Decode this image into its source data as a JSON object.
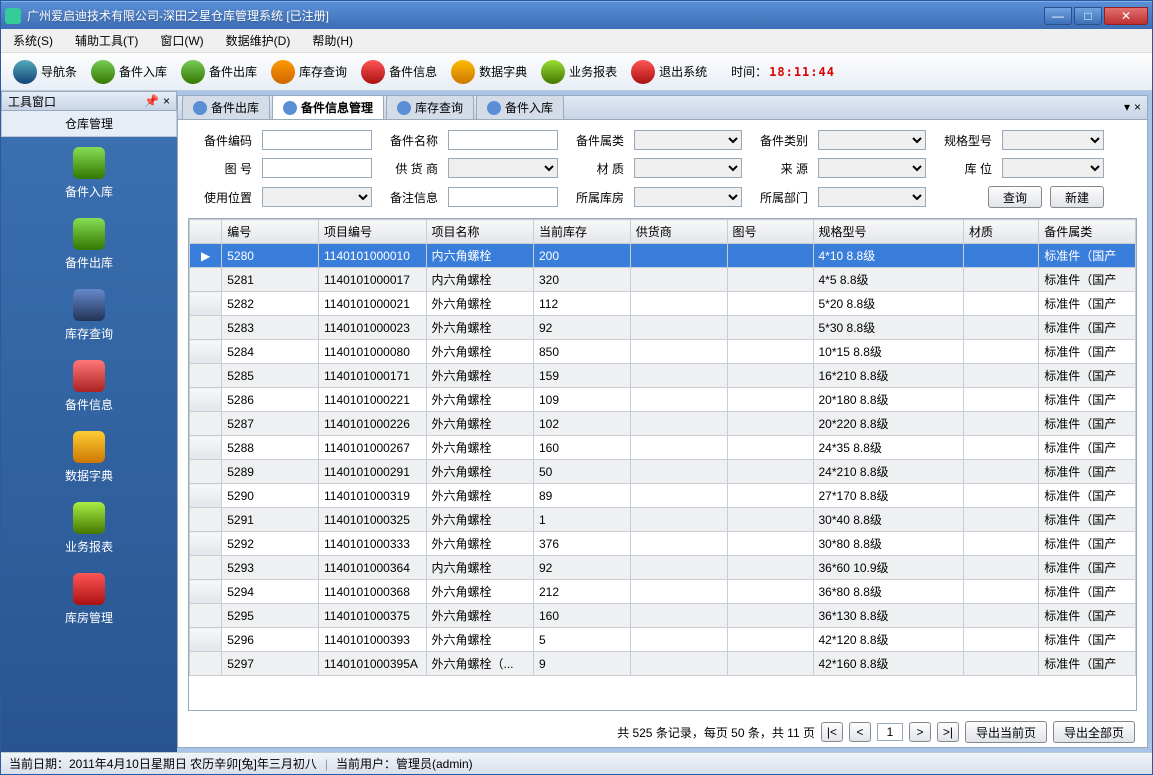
{
  "window": {
    "title": "广州爱启迪技术有限公司-深田之星仓库管理系统 [已注册]"
  },
  "menu": [
    "系统(S)",
    "辅助工具(T)",
    "窗口(W)",
    "数据维护(D)",
    "帮助(H)"
  ],
  "toolbar": [
    {
      "label": "导航条",
      "ico": "ico-nav"
    },
    {
      "label": "备件入库",
      "ico": "ico-in"
    },
    {
      "label": "备件出库",
      "ico": "ico-out"
    },
    {
      "label": "库存查询",
      "ico": "ico-srch"
    },
    {
      "label": "备件信息",
      "ico": "ico-info"
    },
    {
      "label": "数据字典",
      "ico": "ico-dict"
    },
    {
      "label": "业务报表",
      "ico": "ico-rpt"
    },
    {
      "label": "退出系统",
      "ico": "ico-exit"
    }
  ],
  "time_label": "时间：",
  "time_value": "18:11:44",
  "sidebar": {
    "toolwin": "工具窗口",
    "title": "仓库管理",
    "items": [
      {
        "label": "备件入库",
        "ico": "sico-in"
      },
      {
        "label": "备件出库",
        "ico": "sico-out"
      },
      {
        "label": "库存查询",
        "ico": "sico-srch"
      },
      {
        "label": "备件信息",
        "ico": "sico-info"
      },
      {
        "label": "数据字典",
        "ico": "sico-dict"
      },
      {
        "label": "业务报表",
        "ico": "sico-rpt"
      },
      {
        "label": "库房管理",
        "ico": "sico-wh"
      }
    ]
  },
  "tabs": [
    {
      "label": "备件出库",
      "active": false
    },
    {
      "label": "备件信息管理",
      "active": true
    },
    {
      "label": "库存查询",
      "active": false
    },
    {
      "label": "备件入库",
      "active": false
    }
  ],
  "filter": {
    "f1": "备件编码",
    "f2": "备件名称",
    "f3": "备件属类",
    "f4": "备件类别",
    "f5": "规格型号",
    "f6": "图 号",
    "f7": "供 货 商",
    "f8": "材 质",
    "f9": "来 源",
    "f10": "库 位",
    "f11": "使用位置",
    "f12": "备注信息",
    "f13": "所属库房",
    "f14": "所属部门",
    "btn_query": "查询",
    "btn_new": "新建"
  },
  "columns": [
    "编号",
    "项目编号",
    "项目名称",
    "当前库存",
    "供货商",
    "图号",
    "规格型号",
    "材质",
    "备件属类"
  ],
  "rows": [
    {
      "c0": "5280",
      "c1": "1140101000010",
      "c2": "内六角螺栓",
      "c3": "200",
      "c4": "",
      "c5": "",
      "c6": "4*10    8.8级",
      "c7": "",
      "c8": "标准件（国产",
      "sel": true
    },
    {
      "c0": "5281",
      "c1": "1140101000017",
      "c2": "内六角螺栓",
      "c3": "320",
      "c4": "",
      "c5": "",
      "c6": "4*5    8.8级",
      "c7": "",
      "c8": "标准件（国产"
    },
    {
      "c0": "5282",
      "c1": "1140101000021",
      "c2": "外六角螺栓",
      "c3": "112",
      "c4": "",
      "c5": "",
      "c6": "5*20    8.8级",
      "c7": "",
      "c8": "标准件（国产"
    },
    {
      "c0": "5283",
      "c1": "1140101000023",
      "c2": "外六角螺栓",
      "c3": "92",
      "c4": "",
      "c5": "",
      "c6": "5*30    8.8级",
      "c7": "",
      "c8": "标准件（国产"
    },
    {
      "c0": "5284",
      "c1": "1140101000080",
      "c2": "外六角螺栓",
      "c3": "850",
      "c4": "",
      "c5": "",
      "c6": "10*15    8.8级",
      "c7": "",
      "c8": "标准件（国产"
    },
    {
      "c0": "5285",
      "c1": "1140101000171",
      "c2": "外六角螺栓",
      "c3": "159",
      "c4": "",
      "c5": "",
      "c6": "16*210    8.8级",
      "c7": "",
      "c8": "标准件（国产"
    },
    {
      "c0": "5286",
      "c1": "1140101000221",
      "c2": "外六角螺栓",
      "c3": "109",
      "c4": "",
      "c5": "",
      "c6": "20*180    8.8级",
      "c7": "",
      "c8": "标准件（国产"
    },
    {
      "c0": "5287",
      "c1": "1140101000226",
      "c2": "外六角螺栓",
      "c3": "102",
      "c4": "",
      "c5": "",
      "c6": "20*220    8.8级",
      "c7": "",
      "c8": "标准件（国产"
    },
    {
      "c0": "5288",
      "c1": "1140101000267",
      "c2": "外六角螺栓",
      "c3": "160",
      "c4": "",
      "c5": "",
      "c6": "24*35    8.8级",
      "c7": "",
      "c8": "标准件（国产"
    },
    {
      "c0": "5289",
      "c1": "1140101000291",
      "c2": "外六角螺栓",
      "c3": "50",
      "c4": "",
      "c5": "",
      "c6": "24*210    8.8级",
      "c7": "",
      "c8": "标准件（国产"
    },
    {
      "c0": "5290",
      "c1": "1140101000319",
      "c2": "外六角螺栓",
      "c3": "89",
      "c4": "",
      "c5": "",
      "c6": "27*170    8.8级",
      "c7": "",
      "c8": "标准件（国产"
    },
    {
      "c0": "5291",
      "c1": "1140101000325",
      "c2": "外六角螺栓",
      "c3": "1",
      "c4": "",
      "c5": "",
      "c6": "30*40    8.8级",
      "c7": "",
      "c8": "标准件（国产"
    },
    {
      "c0": "5292",
      "c1": "1140101000333",
      "c2": "外六角螺栓",
      "c3": "376",
      "c4": "",
      "c5": "",
      "c6": "30*80    8.8级",
      "c7": "",
      "c8": "标准件（国产"
    },
    {
      "c0": "5293",
      "c1": "1140101000364",
      "c2": "内六角螺栓",
      "c3": "92",
      "c4": "",
      "c5": "",
      "c6": "36*60    10.9级",
      "c7": "",
      "c8": "标准件（国产"
    },
    {
      "c0": "5294",
      "c1": "1140101000368",
      "c2": "外六角螺栓",
      "c3": "212",
      "c4": "",
      "c5": "",
      "c6": "36*80    8.8级",
      "c7": "",
      "c8": "标准件（国产"
    },
    {
      "c0": "5295",
      "c1": "1140101000375",
      "c2": "外六角螺栓",
      "c3": "160",
      "c4": "",
      "c5": "",
      "c6": "36*130  8.8级",
      "c7": "",
      "c8": "标准件（国产"
    },
    {
      "c0": "5296",
      "c1": "1140101000393",
      "c2": "外六角螺栓",
      "c3": "5",
      "c4": "",
      "c5": "",
      "c6": "42*120    8.8级",
      "c7": "",
      "c8": "标准件（国产"
    },
    {
      "c0": "5297",
      "c1": "1140101000395A",
      "c2": "外六角螺栓（...",
      "c3": "9",
      "c4": "",
      "c5": "",
      "c6": "42*160  8.8级",
      "c7": "",
      "c8": "标准件（国产"
    }
  ],
  "pager": {
    "summary": "共 525 条记录，每页 50 条，共 11 页",
    "page": "1",
    "export_cur": "导出当前页",
    "export_all": "导出全部页"
  },
  "status": {
    "date": "当前日期：2011年4月10日星期日 农历辛卯[兔]年三月初八",
    "user": "当前用户：管理员(admin)"
  }
}
